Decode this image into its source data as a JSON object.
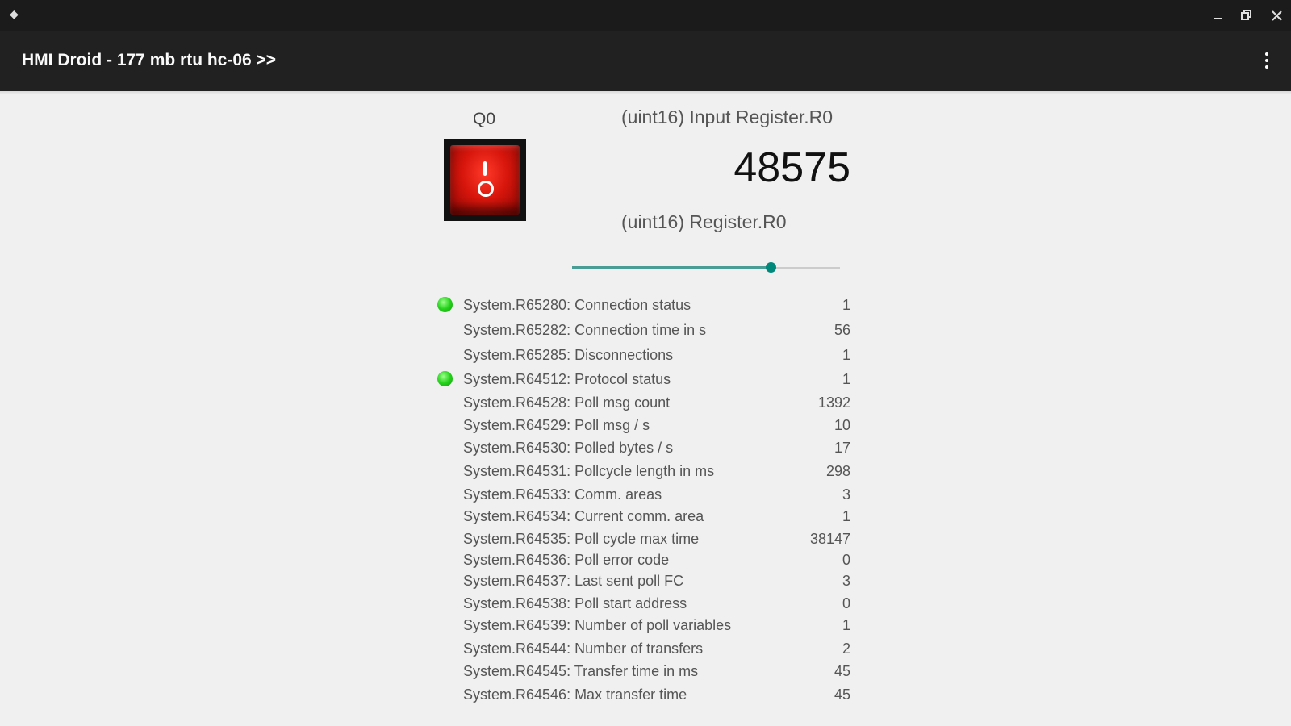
{
  "titlebar": {
    "icon": "app-diamond-icon"
  },
  "appbar": {
    "title": "HMI Droid - 177 mb rtu hc-06 >>",
    "menu_icon": "more-vert-icon"
  },
  "coil": {
    "label": "Q0",
    "state": "on"
  },
  "input_register": {
    "label": "(uint16) Input Register.R0",
    "value": "48575"
  },
  "register": {
    "label": "(uint16) Register.R0",
    "slider_fraction": 0.74
  },
  "colors": {
    "accent": "#00897b",
    "led_green": "#25d21b",
    "switch_red": "#d8160c"
  },
  "status_rows": [
    {
      "label": "System.R65280: Connection status",
      "value": "1",
      "led": true
    },
    {
      "label": "System.R65282: Connection time in s",
      "value": "56",
      "led": false
    },
    {
      "label": "System.R65285: Disconnections",
      "value": "1",
      "led": false
    },
    {
      "label": "System.R64512: Protocol status",
      "value": "1",
      "led": true
    },
    {
      "label": "System.R64528: Poll msg count",
      "value": "1392",
      "led": false
    },
    {
      "label": "System.R64529: Poll msg / s",
      "value": "10",
      "led": false
    },
    {
      "label": "System.R64530: Polled bytes / s",
      "value": "17",
      "led": false
    },
    {
      "label": "System.R64531: Pollcycle length in ms",
      "value": "298",
      "led": false
    },
    {
      "label": "System.R64533: Comm. areas",
      "value": "3",
      "led": false
    },
    {
      "label": "System.R64534: Current comm. area",
      "value": "1",
      "led": false
    },
    {
      "label": "System.R64535: Poll cycle max time",
      "value": "38147",
      "led": false
    },
    {
      "label": "System.R64536: Poll error code",
      "value": "0",
      "led": false
    },
    {
      "label": "System.R64537: Last sent poll FC",
      "value": "3",
      "led": false
    },
    {
      "label": "System.R64538: Poll start address",
      "value": "0",
      "led": false
    },
    {
      "label": "System.R64539: Number of poll variables",
      "value": "1",
      "led": false
    },
    {
      "label": "System.R64544: Number of transfers",
      "value": "2",
      "led": false
    },
    {
      "label": "System.R64545: Transfer time in ms",
      "value": "45",
      "led": false
    },
    {
      "label": "System.R64546: Max transfer time",
      "value": "45",
      "led": false
    }
  ]
}
